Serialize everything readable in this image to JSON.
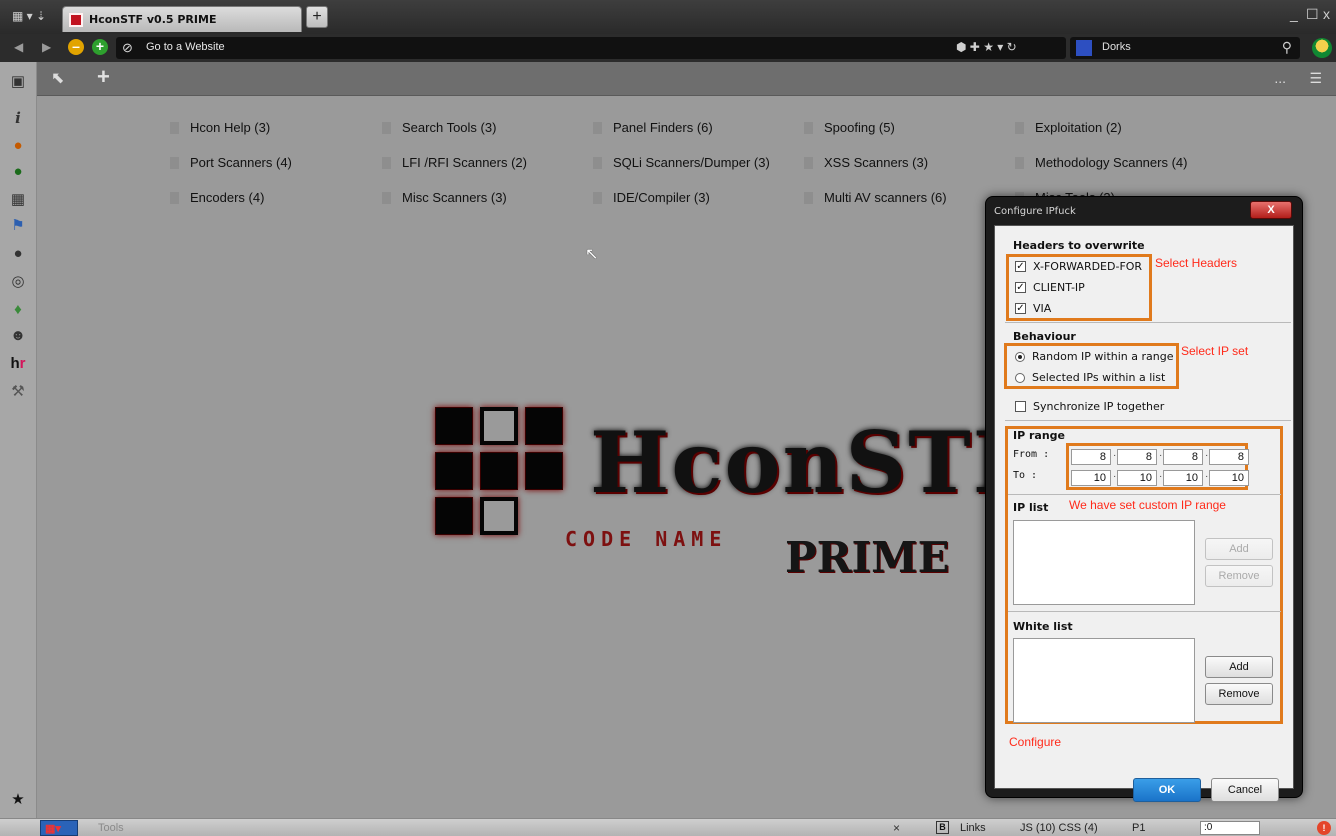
{
  "browser": {
    "tab_title": "HconSTF v0.5 PRIME",
    "new_tab": "+",
    "url_placeholder": "Go to a Website",
    "dorks_label": "Dorks",
    "window_controls": [
      "_",
      "☐",
      "x"
    ]
  },
  "toolbar": {
    "dots": "...",
    "list": "☰"
  },
  "dials": [
    {
      "label": "Hcon Help (3)"
    },
    {
      "label": "Search Tools (3)"
    },
    {
      "label": "Panel Finders (6)"
    },
    {
      "label": "Spoofing (5)"
    },
    {
      "label": "Exploitation (2)"
    },
    {
      "label": "Port Scanners (4)"
    },
    {
      "label": "LFI /RFI Scanners (2)"
    },
    {
      "label": "SQLi Scanners/Dumper (3)"
    },
    {
      "label": "XSS Scanners (3)"
    },
    {
      "label": "Methodology Scanners (4)"
    },
    {
      "label": "Encoders (4)"
    },
    {
      "label": "Misc Scanners (3)"
    },
    {
      "label": "IDE/Compiler (3)"
    },
    {
      "label": "Multi AV scanners (6)"
    },
    {
      "label": "Misc Tools (3)"
    }
  ],
  "logo": {
    "main": "HconSTF",
    "code": "CODE NAME",
    "prime": "PRIME"
  },
  "dialog": {
    "title": "Configure IPfuck",
    "close": "X",
    "headers_title": "Headers to overwrite",
    "headers": [
      {
        "label": "X-FORWARDED-FOR",
        "checked": true
      },
      {
        "label": "CLIENT-IP",
        "checked": true
      },
      {
        "label": "VIA",
        "checked": true
      }
    ],
    "behaviour_title": "Behaviour",
    "behaviour_options": [
      {
        "label": "Random IP within a range",
        "selected": true
      },
      {
        "label": "Selected IPs within a list",
        "selected": false
      }
    ],
    "sync_label": "Synchronize IP together",
    "sync_checked": false,
    "ip_range_title": "IP range",
    "from_label": "From :",
    "to_label": "To :",
    "from_ip": [
      "8",
      "8",
      "8",
      "8"
    ],
    "to_ip": [
      "10",
      "10",
      "10",
      "10"
    ],
    "ip_list_title": "IP list",
    "white_list_title": "White list",
    "add": "Add",
    "remove": "Remove",
    "ok": "OK",
    "cancel": "Cancel"
  },
  "annotations": {
    "select_headers": "Select Headers",
    "select_ip_set": "Select IP set",
    "custom_range": "We have set custom IP range",
    "configure": "Configure",
    "color": "#ff2a1a",
    "box_color": "#e07a1c"
  },
  "statusbar": {
    "tools": "Tools",
    "close": "×",
    "b": "B",
    "links": "Links",
    "js_css": "JS (10) CSS (4)",
    "p1": "P1",
    "zoom": ":0"
  }
}
